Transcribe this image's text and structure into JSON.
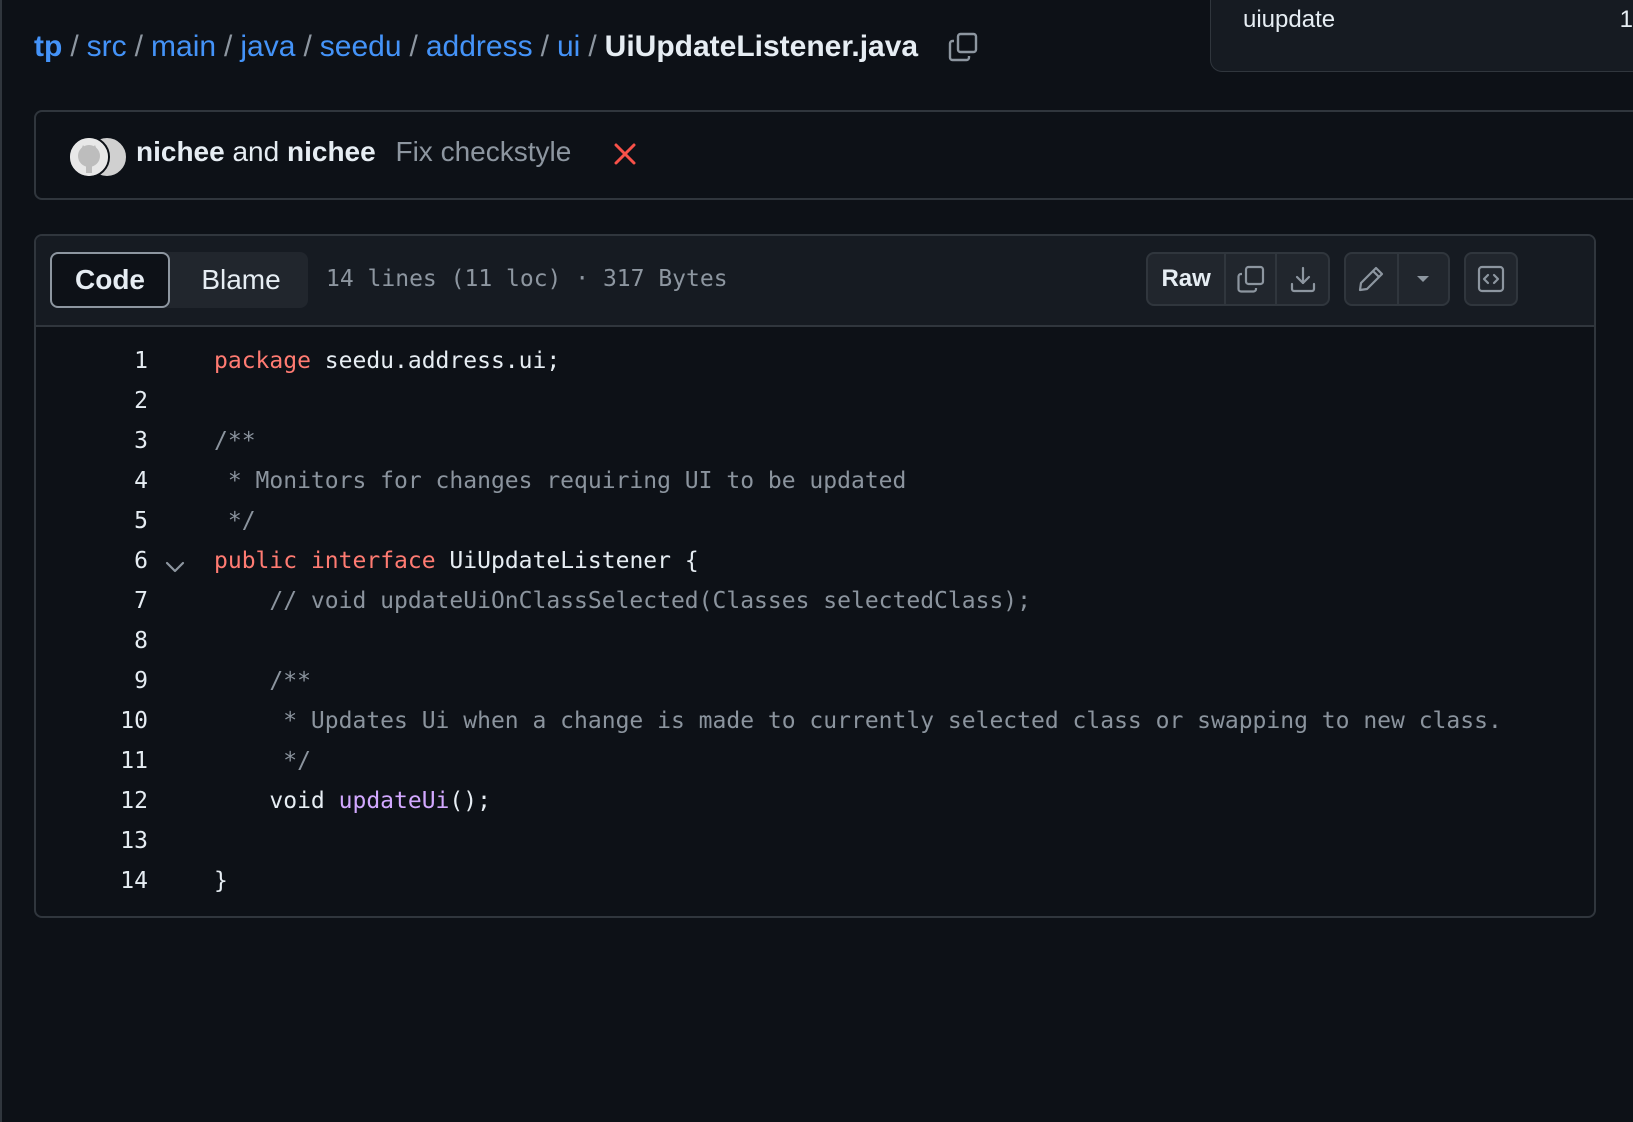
{
  "breadcrumb": {
    "root": "tp",
    "segments": [
      "src",
      "main",
      "java",
      "seedu",
      "address",
      "ui"
    ],
    "separator": "/",
    "file": "UiUpdateListener.java"
  },
  "branch_popover": {
    "name": "uiupdate",
    "count": "1"
  },
  "commit": {
    "author1": "nichee",
    "and": "and",
    "author2": "nichee",
    "message": "Fix checkstyle",
    "status_color": "#f85149"
  },
  "file": {
    "tab_code": "Code",
    "tab_blame": "Blame",
    "meta": "14 lines (11 loc) · 317 Bytes",
    "raw_label": "Raw"
  },
  "code_lines": [
    {
      "n": "1",
      "fold": false,
      "tokens": [
        {
          "t": "package",
          "k": "kw"
        },
        {
          "t": " seedu.address.ui;",
          "k": "tx"
        }
      ]
    },
    {
      "n": "2",
      "fold": false,
      "tokens": []
    },
    {
      "n": "3",
      "fold": false,
      "tokens": [
        {
          "t": "/**",
          "k": "cm"
        }
      ]
    },
    {
      "n": "4",
      "fold": false,
      "tokens": [
        {
          "t": " * Monitors for changes requiring UI to be updated",
          "k": "cm"
        }
      ]
    },
    {
      "n": "5",
      "fold": false,
      "tokens": [
        {
          "t": " */",
          "k": "cm"
        }
      ]
    },
    {
      "n": "6",
      "fold": true,
      "tokens": [
        {
          "t": "public",
          "k": "kw"
        },
        {
          "t": " ",
          "k": "tx"
        },
        {
          "t": "interface",
          "k": "kw"
        },
        {
          "t": " UiUpdateListener {",
          "k": "tx"
        }
      ]
    },
    {
      "n": "7",
      "fold": false,
      "tokens": [
        {
          "t": "    // void updateUiOnClassSelected(Classes selectedClass);",
          "k": "cm"
        }
      ]
    },
    {
      "n": "8",
      "fold": false,
      "tokens": []
    },
    {
      "n": "9",
      "fold": false,
      "tokens": [
        {
          "t": "    /**",
          "k": "cm"
        }
      ]
    },
    {
      "n": "10",
      "fold": false,
      "tokens": [
        {
          "t": "     * Updates Ui when a change is made to currently selected class or swapping to new class.",
          "k": "cm"
        }
      ]
    },
    {
      "n": "11",
      "fold": false,
      "tokens": [
        {
          "t": "     */",
          "k": "cm"
        }
      ]
    },
    {
      "n": "12",
      "fold": false,
      "tokens": [
        {
          "t": "    void ",
          "k": "tx"
        },
        {
          "t": "updateUi",
          "k": "fn"
        },
        {
          "t": "();",
          "k": "tx"
        }
      ]
    },
    {
      "n": "13",
      "fold": false,
      "tokens": []
    },
    {
      "n": "14",
      "fold": false,
      "tokens": [
        {
          "t": "}",
          "k": "tx"
        }
      ]
    }
  ],
  "icons": {
    "copy_path": "copy-icon",
    "copy_raw": "copy-icon",
    "download": "download-icon",
    "edit": "pencil-icon",
    "more_edit": "triangle-down-icon",
    "symbols": "code-square-icon",
    "fold": "chevron-down-icon",
    "status": "x-icon"
  }
}
